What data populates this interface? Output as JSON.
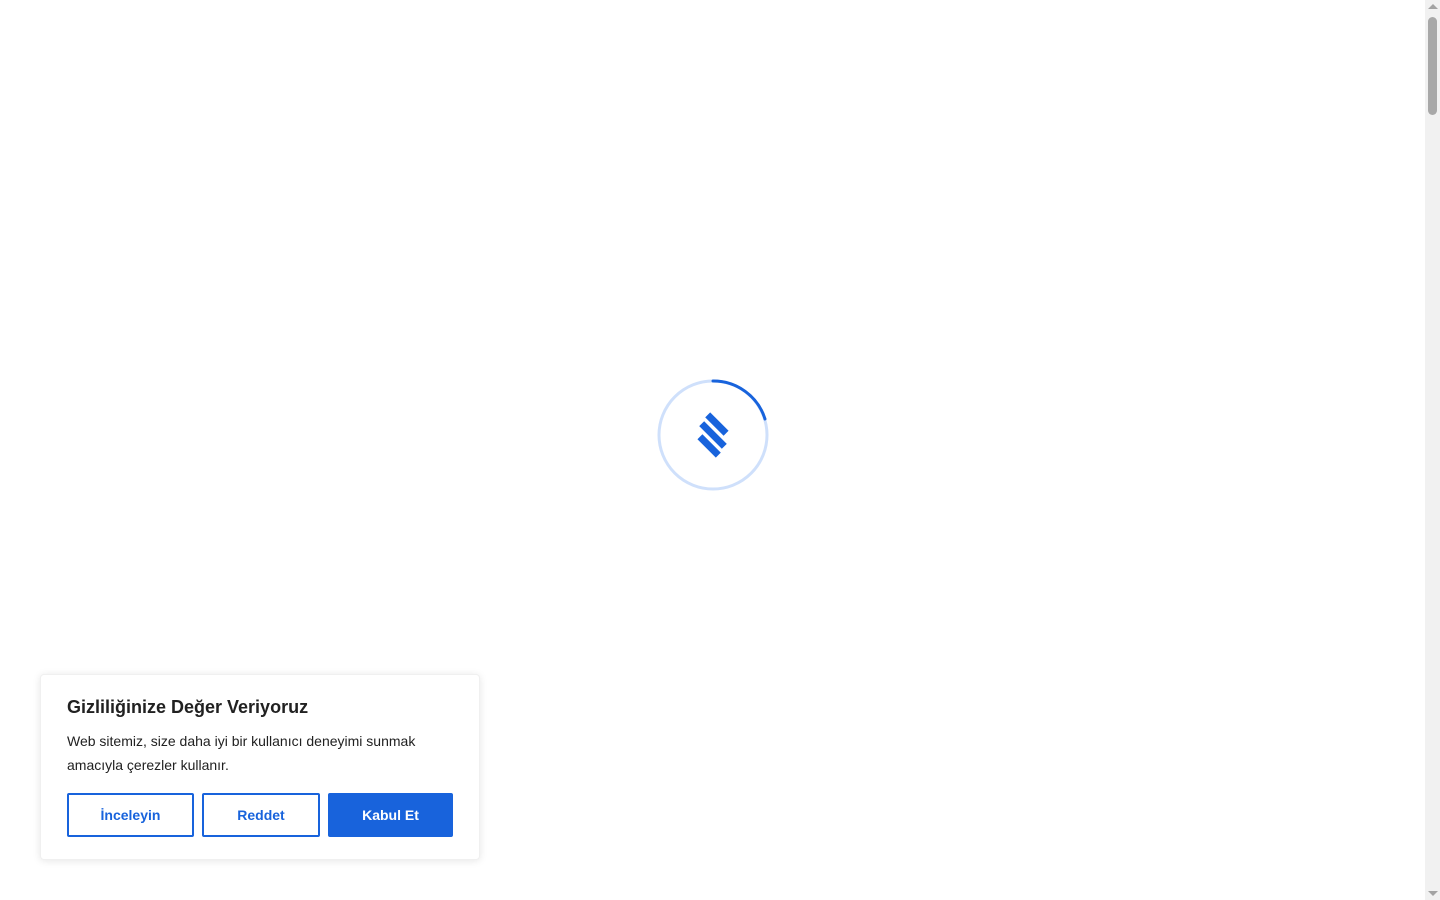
{
  "loader": {
    "icon": "brand-logo-icon",
    "accent_color": "#1863dc"
  },
  "cookie_banner": {
    "title": "Gizliliğinize Değer Veriyoruz",
    "text": "Web sitemiz, size daha iyi bir kullanıcı deneyimi sunmak amacıyla çerezler kullanır.",
    "buttons": {
      "review": "İnceleyin",
      "reject": "Reddet",
      "accept": "Kabul Et"
    }
  }
}
